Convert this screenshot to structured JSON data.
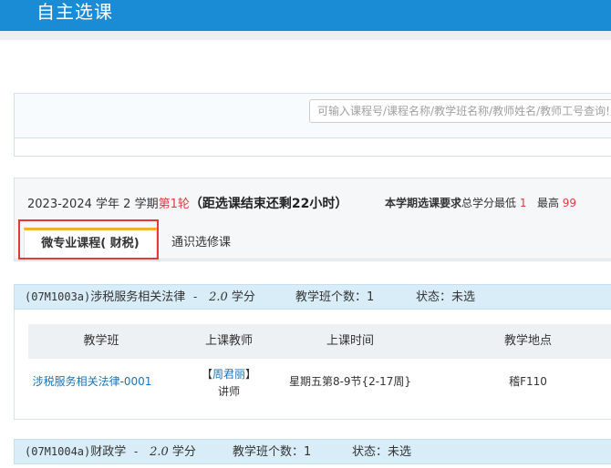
{
  "header": {
    "title": "自主选课"
  },
  "search": {
    "placeholder": "可输入课程号/课程名称/教学班名称/教师姓名/教师工号查询!"
  },
  "term": {
    "year": "2023-2024",
    "year_suffix": "学年",
    "term_no": "2",
    "term_suffix": "学期",
    "round": "第1轮",
    "countdown": "（距选课结束还剩22小时）",
    "requirement_label": "本学期选课要求",
    "min_label": "总学分最低",
    "min_value": "1",
    "max_label": "最高",
    "max_value": "99"
  },
  "tabs": [
    {
      "label": "微专业课程( 财税)"
    },
    {
      "label": "通识选修课"
    }
  ],
  "courses": [
    {
      "code": "(07M1003a)",
      "name": "涉税服务相关法律",
      "dash": " - ",
      "credit": "2.0",
      "credit_unit": "学分",
      "class_count_label": "教学班个数：",
      "class_count": "1",
      "status_label": "状态：",
      "status": "未选",
      "table": {
        "columns": [
          "教学班",
          "上课教师",
          "上课时间",
          "教学地点"
        ],
        "rows": [
          {
            "class_name": "涉税服务相关法律-0001",
            "teacher_open": "【",
            "teacher": "周君丽",
            "teacher_close": "】",
            "teacher_title": "讲师",
            "time": "星期五第8-9节{2-17周}",
            "location": "稽F110"
          }
        ]
      }
    },
    {
      "code": "(07M1004a)",
      "name": "财政学",
      "dash": " - ",
      "credit": "2.0",
      "credit_unit": "学分",
      "class_count_label": "教学班个数：",
      "class_count": "1",
      "status_label": "状态：",
      "status": "未选"
    }
  ],
  "colors": {
    "header_bg": "#1a8bd5",
    "accent_red": "#e4393c",
    "tab_accent": "#f2b22c",
    "link": "#1a73b8"
  }
}
